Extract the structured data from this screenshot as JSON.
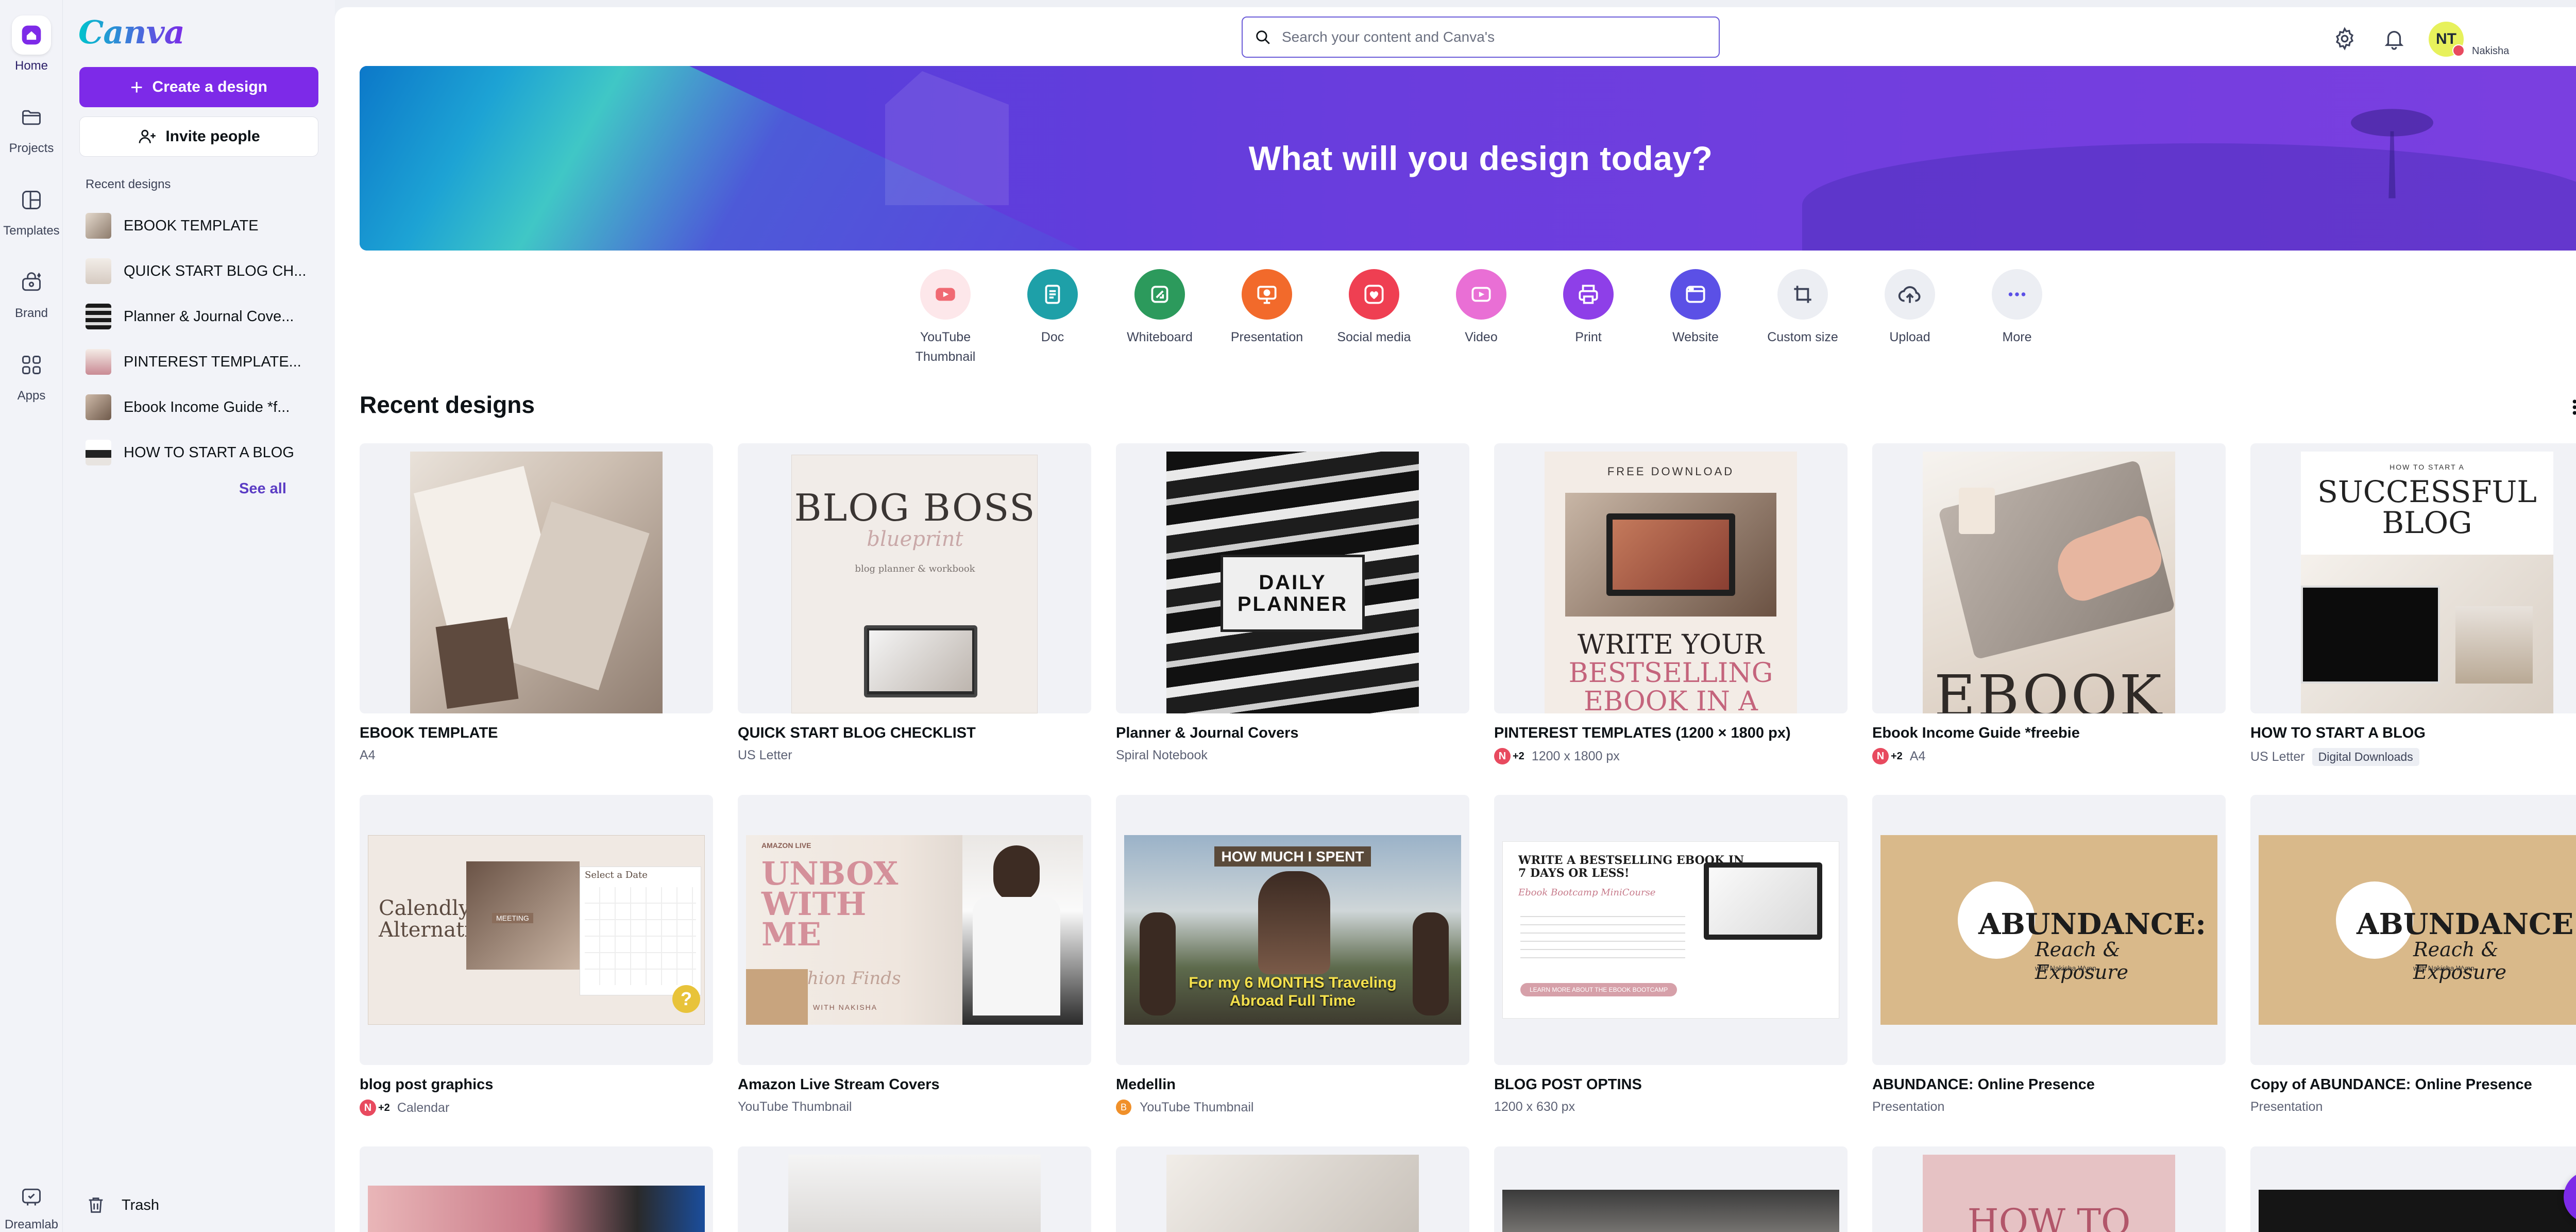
{
  "rail": {
    "items": [
      {
        "label": "Home",
        "icon": "home-icon"
      },
      {
        "label": "Projects",
        "icon": "folder-icon"
      },
      {
        "label": "Templates",
        "icon": "templates-icon"
      },
      {
        "label": "Brand",
        "icon": "brand-icon"
      },
      {
        "label": "Apps",
        "icon": "apps-icon"
      }
    ],
    "bottom_label": "Dreamlab",
    "active": "Home"
  },
  "sidebar": {
    "logo": "Canva",
    "create_label": "Create a design",
    "invite_label": "Invite people",
    "recent_heading": "Recent designs",
    "recent_items": [
      {
        "label": "EBOOK TEMPLATE"
      },
      {
        "label": "QUICK START BLOG CH..."
      },
      {
        "label": "Planner & Journal Cove..."
      },
      {
        "label": "PINTEREST TEMPLATE..."
      },
      {
        "label": "Ebook Income Guide *f..."
      },
      {
        "label": "HOW TO START A BLOG"
      }
    ],
    "see_all": "See all",
    "trash_label": "Trash"
  },
  "header": {
    "search_placeholder": "Search your content and Canva's",
    "user_initials": "NT",
    "user_name": "Nakisha"
  },
  "hero": {
    "title": "What will you design today?"
  },
  "shortcuts": [
    {
      "label": "YouTube Thumbnail",
      "icon": "youtube-icon",
      "color": "#f06a73",
      "bg": "#fde7ea"
    },
    {
      "label": "Doc",
      "icon": "doc-icon",
      "color": "#ffffff",
      "bg": "#1ea0a8"
    },
    {
      "label": "Whiteboard",
      "icon": "whiteboard-icon",
      "color": "#ffffff",
      "bg": "#2c9a5c"
    },
    {
      "label": "Presentation",
      "icon": "presentation-icon",
      "color": "#ffffff",
      "bg": "#f26a2b"
    },
    {
      "label": "Social media",
      "icon": "heart-icon",
      "color": "#ffffff",
      "bg": "#ef3f52"
    },
    {
      "label": "Video",
      "icon": "video-icon",
      "color": "#ffffff",
      "bg": "#e96fd5"
    },
    {
      "label": "Print",
      "icon": "print-icon",
      "color": "#ffffff",
      "bg": "#8e3fe8"
    },
    {
      "label": "Website",
      "icon": "website-icon",
      "color": "#ffffff",
      "bg": "#5b50e6"
    },
    {
      "label": "Custom size",
      "icon": "custom-size-icon",
      "color": "#3c4257",
      "bg": "#eceef3"
    },
    {
      "label": "Upload",
      "icon": "upload-icon",
      "color": "#3c4257",
      "bg": "#eceef3"
    },
    {
      "label": "More",
      "icon": "more-icon",
      "color": "#5b50e6",
      "bg": "#eceef3"
    }
  ],
  "recent": {
    "title": "Recent designs",
    "cards": [
      {
        "title": "EBOOK TEMPLATE",
        "meta": "A4",
        "collab": false,
        "tag": ""
      },
      {
        "title": "QUICK START BLOG CHECKLIST",
        "meta": "US Letter",
        "collab": false,
        "tag": ""
      },
      {
        "title": "Planner & Journal Covers",
        "meta": "Spiral Notebook",
        "collab": false,
        "tag": ""
      },
      {
        "title": "PINTEREST TEMPLATES (1200 × 1800 px)",
        "meta": "1200 x 1800 px",
        "collab": true,
        "tag": ""
      },
      {
        "title": "Ebook Income Guide *freebie",
        "meta": "A4",
        "collab": true,
        "tag": ""
      },
      {
        "title": "HOW TO START A BLOG",
        "meta": "US Letter",
        "collab": false,
        "tag": "Digital Downloads"
      },
      {
        "title": "blog post graphics",
        "meta": "Calendar",
        "collab": true,
        "tag": ""
      },
      {
        "title": "Amazon Live Stream Covers",
        "meta": "YouTube Thumbnail",
        "collab": false,
        "tag": ""
      },
      {
        "title": "Medellin",
        "meta": "YouTube Thumbnail",
        "collab": false,
        "tag": "",
        "owner": true
      },
      {
        "title": "BLOG POST OPTINS",
        "meta": "1200 x 630 px",
        "collab": false,
        "tag": ""
      },
      {
        "title": "ABUNDANCE: Online Presence",
        "meta": "Presentation",
        "collab": false,
        "tag": ""
      },
      {
        "title": "Copy of ABUNDANCE: Online Presence",
        "meta": "Presentation",
        "collab": false,
        "tag": ""
      }
    ],
    "collab_initial": "N",
    "collab_more": "+2",
    "owner_initial": "B"
  },
  "art": {
    "blog_boss": "BLOG BOSS",
    "blog_boss_script": "blueprint",
    "blog_boss_sub": "blog planner & workbook",
    "daily_planner": "DAILY\nPLANNER",
    "free_download": "FREE DOWNLOAD",
    "write_your": "WRITE YOUR",
    "bestselling": "BESTSELLING",
    "ebook_in_a": "EBOOK IN A",
    "ebook": "EBOOK",
    "how_to_start": "HOW TO START A",
    "successful": "SUCCESSFUL",
    "blog": "BLOG",
    "calendly": "Calendly\nAlternatives",
    "select_date": "Select a Date",
    "meeting": "MEETING",
    "unbox": "UNBOX\nWITH\nME",
    "amazon_live": "AMAZON LIVE",
    "fashion": "Fashion Finds",
    "with_nakisha": "WITH NAKISHA",
    "how_much": "HOW MUCH I SPENT",
    "for_my": "For my 6 MONTHS Traveling\nAbroad Full Time",
    "optin_title": "WRITE A BESTSELLING EBOOK IN\n7 DAYS OR LESS!",
    "optin_sub": "Ebook Bootcamp MiniCourse",
    "optin_cta": "LEARN MORE ABOUT THE EBOOK BOOTCAMP",
    "abundance": "ABUNDANCE:",
    "abundance_script": "Reach & Exposure",
    "with_nakisha_wynn": "with Nakisha Wynn",
    "how_to": "HOW TO"
  },
  "help_label": "?"
}
